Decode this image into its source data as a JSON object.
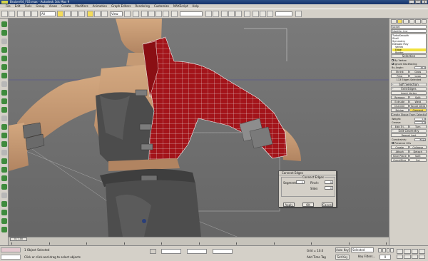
{
  "window": {
    "title": "Bruiser04_F03.max - Autodesk 3ds Max 9",
    "controls": [
      "_",
      "□",
      "x"
    ]
  },
  "menu": {
    "items": [
      "File",
      "Edit",
      "Tools",
      "Group",
      "Views",
      "Create",
      "Modifiers",
      "Animation",
      "Graph Editors",
      "Rendering",
      "Customize",
      "MAXScript",
      "Help"
    ]
  },
  "toolbar": {
    "filter": "All",
    "refcoord": "View",
    "selset": ""
  },
  "viewport": {
    "label": ""
  },
  "timeline": {
    "position": "0 / 100",
    "ticks": [
      "0",
      "10",
      "20",
      "30",
      "40",
      "50",
      "60",
      "70",
      "80",
      "90",
      "100"
    ]
  },
  "status": {
    "selection": "1 Object Selected",
    "prompt": "Click or click-and-drag to select objects",
    "grid": "Grid = 10.0",
    "add_time_tag": "Add Time Tag",
    "auto_key": "Auto Key",
    "set_key": "Set Key",
    "selected": "Selected",
    "key_filters": "Key Filters...",
    "frame": "0"
  },
  "panel": {
    "object_name": "Jacket",
    "modifier_list": "Modifier List",
    "stack": [
      "TurboSmooth",
      "Shell",
      "Symmetry",
      "Editable Poly",
      "Vertex",
      "Edge",
      "Border",
      "Polygon"
    ],
    "stack_selected": "Edge",
    "selection": {
      "title": "Selection",
      "by_vertex": "By Vertex",
      "ignore_backfacing": "Ignore Backfacing",
      "by_angle": "By Angle:",
      "angle": "45.0",
      "shrink": "Shrink",
      "grow": "Grow",
      "ring": "Ring",
      "loop": "Loop",
      "count": "113 Edges Selected"
    },
    "soft_selection": "Soft Selection",
    "edit_edges": {
      "title": "Edit Edges",
      "insert_vertex": "Insert Vertex",
      "remove": "Remove",
      "split": "Split",
      "extrude": "Extrude",
      "weld": "Weld",
      "chamfer": "Chamfer",
      "target_weld": "Target Weld",
      "bridge": "Bridge",
      "connect": "Connect",
      "create_shape": "Create Shape From Selection",
      "weight": "Weight:",
      "weight_val": "1.0",
      "crease": "Crease:",
      "crease_val": "0.0",
      "edit_tri": "Edit Tri.",
      "turn": "Turn"
    },
    "edit_geometry": {
      "title": "Edit Geometry",
      "repeat_last": "Repeat Last",
      "constraints": "Constraints:",
      "constraints_val": "Edge",
      "preserve_uvs": "Preserve UVs",
      "create": "Create",
      "collapse": "Collapse",
      "attach": "Attach",
      "detach": "Detach",
      "slice_plane": "Slice Plane",
      "split": "Split",
      "slice": "Slice",
      "reset_plane": "Reset Plane",
      "quickslice": "QuickSlice",
      "cut": "Cut",
      "msmooth": "MSmooth",
      "tessellate": "Tessellate",
      "make_planar": "Make Planar",
      "view_align": "View Align",
      "grid_align": "Grid Align",
      "relax": "Relax",
      "hide_selected": "Hide Selected",
      "unhide_all": "Unhide All",
      "hide_unselected": "Hide Unselected",
      "named_selections": "Named Selections:",
      "copy": "Copy",
      "paste": "Paste",
      "delete_isolated": "Delete Isolated Vertices",
      "full_interactivity": "Full Interactivity"
    },
    "subdivision_surface": {
      "title": "Subdivision Surface",
      "smooth_result": "Smooth Result",
      "use_nurms": "Use NURMS Subdivision",
      "isoline": "Isoline Display",
      "show_cage": "Show Cage......",
      "display": "Display",
      "iterations": "Iterations:",
      "iterations_val": "1",
      "smoothness": "Smoothness:",
      "smoothness_val": "1.0",
      "render": "Render",
      "r_iterations_val": "0",
      "r_smoothness_val": "1.0",
      "separate_by": "Separate By",
      "smoothing_groups": "Smoothing Groups",
      "materials": "Materials",
      "update_options": "Update Options",
      "always": "Always",
      "when_rendering": "When Rendering",
      "manually": "Manually",
      "update": "Update"
    },
    "subdivision_displacement": {
      "title": "Subdivision Displacement",
      "subdivision_displacement": "Subdivision Displacement",
      "split_mesh": "Split Mesh",
      "subdivision_presets": "Subdivision Presets",
      "low": "Low",
      "medium": "Medium",
      "high": "High"
    }
  },
  "dialog": {
    "title": "Connect Edges",
    "group": "Connect Edges",
    "segments": "Segments:",
    "segments_val": "1",
    "pinch": "Pinch:",
    "pinch_val": "0",
    "slide": "Slide:",
    "slide_val": "0",
    "apply": "Apply",
    "ok": "OK",
    "cancel": "Cancel"
  },
  "colors": {
    "selection_highlight": "#f1e23d",
    "jacket": "#a3141a",
    "viewport_bg": "#6e6e6e",
    "title_blue": "#16336a"
  }
}
